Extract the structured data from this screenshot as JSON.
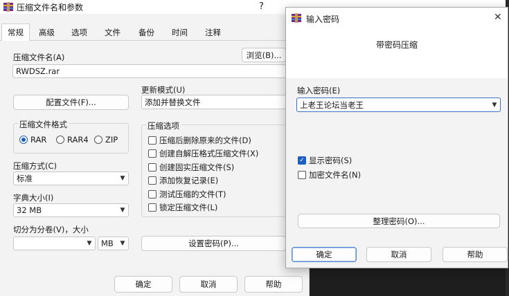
{
  "main_window": {
    "title": "压缩文件名和参数",
    "help_glyph": "?",
    "tabs": [
      "常规",
      "高级",
      "选项",
      "文件",
      "备份",
      "时间",
      "注释"
    ],
    "archive_name_label": "压缩文件名(A)",
    "browse_button": "浏览(B)...",
    "archive_name_value": "RWDSZ.rar",
    "profiles_button": "配置文件(F)...",
    "update_mode_label": "更新模式(U)",
    "update_mode_value": "添加并替换文件",
    "format_group_label": "压缩文件格式",
    "formats": [
      "RAR",
      "RAR4",
      "ZIP"
    ],
    "selected_format": "RAR",
    "options_group_label": "压缩选项",
    "options": [
      "压缩后删除原来的文件(D)",
      "创建自解压格式压缩文件(X)",
      "创建固实压缩文件(S)",
      "添加恢复记录(E)",
      "测试压缩的文件(T)",
      "锁定压缩文件(L)"
    ],
    "method_label": "压缩方式(C)",
    "method_value": "标准",
    "dict_label": "字典大小(I)",
    "dict_value": "32 MB",
    "split_label": "切分为分卷(V)，大小",
    "split_value": "",
    "split_unit": "MB",
    "set_password_button": "设置密码(P)...",
    "ok_button": "确定",
    "cancel_button": "取消",
    "help_button": "帮助"
  },
  "password_dialog": {
    "title": "输入密码",
    "close_glyph": "✕",
    "heading": "带密码压缩",
    "password_label": "输入密码(E)",
    "password_value": "上老王论坛当老王",
    "show_password_label": "显示密码(S)",
    "show_password_checked": true,
    "encrypt_names_label": "加密文件名(N)",
    "encrypt_names_checked": false,
    "organize_button": "整理密码(O)...",
    "ok_button": "确定",
    "cancel_button": "取消",
    "help_button": "帮助"
  },
  "colors": {
    "accent": "#1f5fbf",
    "dialog_bg": "#f3f3f3",
    "background_dark": "#1e1e1e"
  }
}
